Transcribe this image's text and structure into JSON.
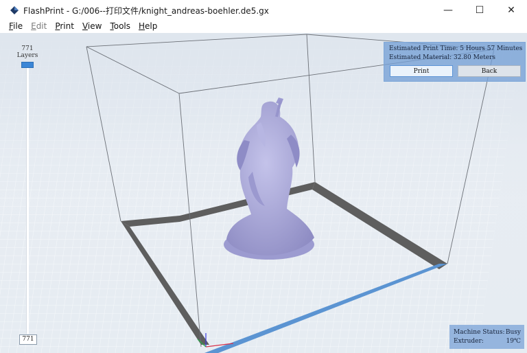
{
  "window": {
    "title": "FlashPrint - G:/006--打印文件/knight_andreas-boehler.de5.gx",
    "minimize_glyph": "—",
    "maximize_glyph": "☐",
    "close_glyph": "✕"
  },
  "menu": [
    {
      "label_hot": "F",
      "label_rest": "ile",
      "enabled": true
    },
    {
      "label_hot": "E",
      "label_rest": "dit",
      "enabled": false
    },
    {
      "label_hot": "P",
      "label_rest": "rint",
      "enabled": true
    },
    {
      "label_hot": "V",
      "label_rest": "iew",
      "enabled": true
    },
    {
      "label_hot": "T",
      "label_rest": "ools",
      "enabled": true
    },
    {
      "label_hot": "H",
      "label_rest": "elp",
      "enabled": true
    }
  ],
  "layers": {
    "count_top": "771",
    "label": "Layers",
    "input_value": "771"
  },
  "info": {
    "print_time": "Estimated Print Time: 5 Hours 57 Minutes",
    "material": "Estimated Material:  32.80 Meters",
    "print_button": "Print",
    "back_button": "Back"
  },
  "status": {
    "machine_label": "Machine Status:",
    "machine_value": "Busy",
    "extruder_label": "Extruder:",
    "extruder_value": "19℃"
  },
  "colors": {
    "accent": "#3b86d6",
    "model": "#a9a8d6",
    "plate_border": "#5a5a5a",
    "plate_front": "#5b94d2"
  }
}
